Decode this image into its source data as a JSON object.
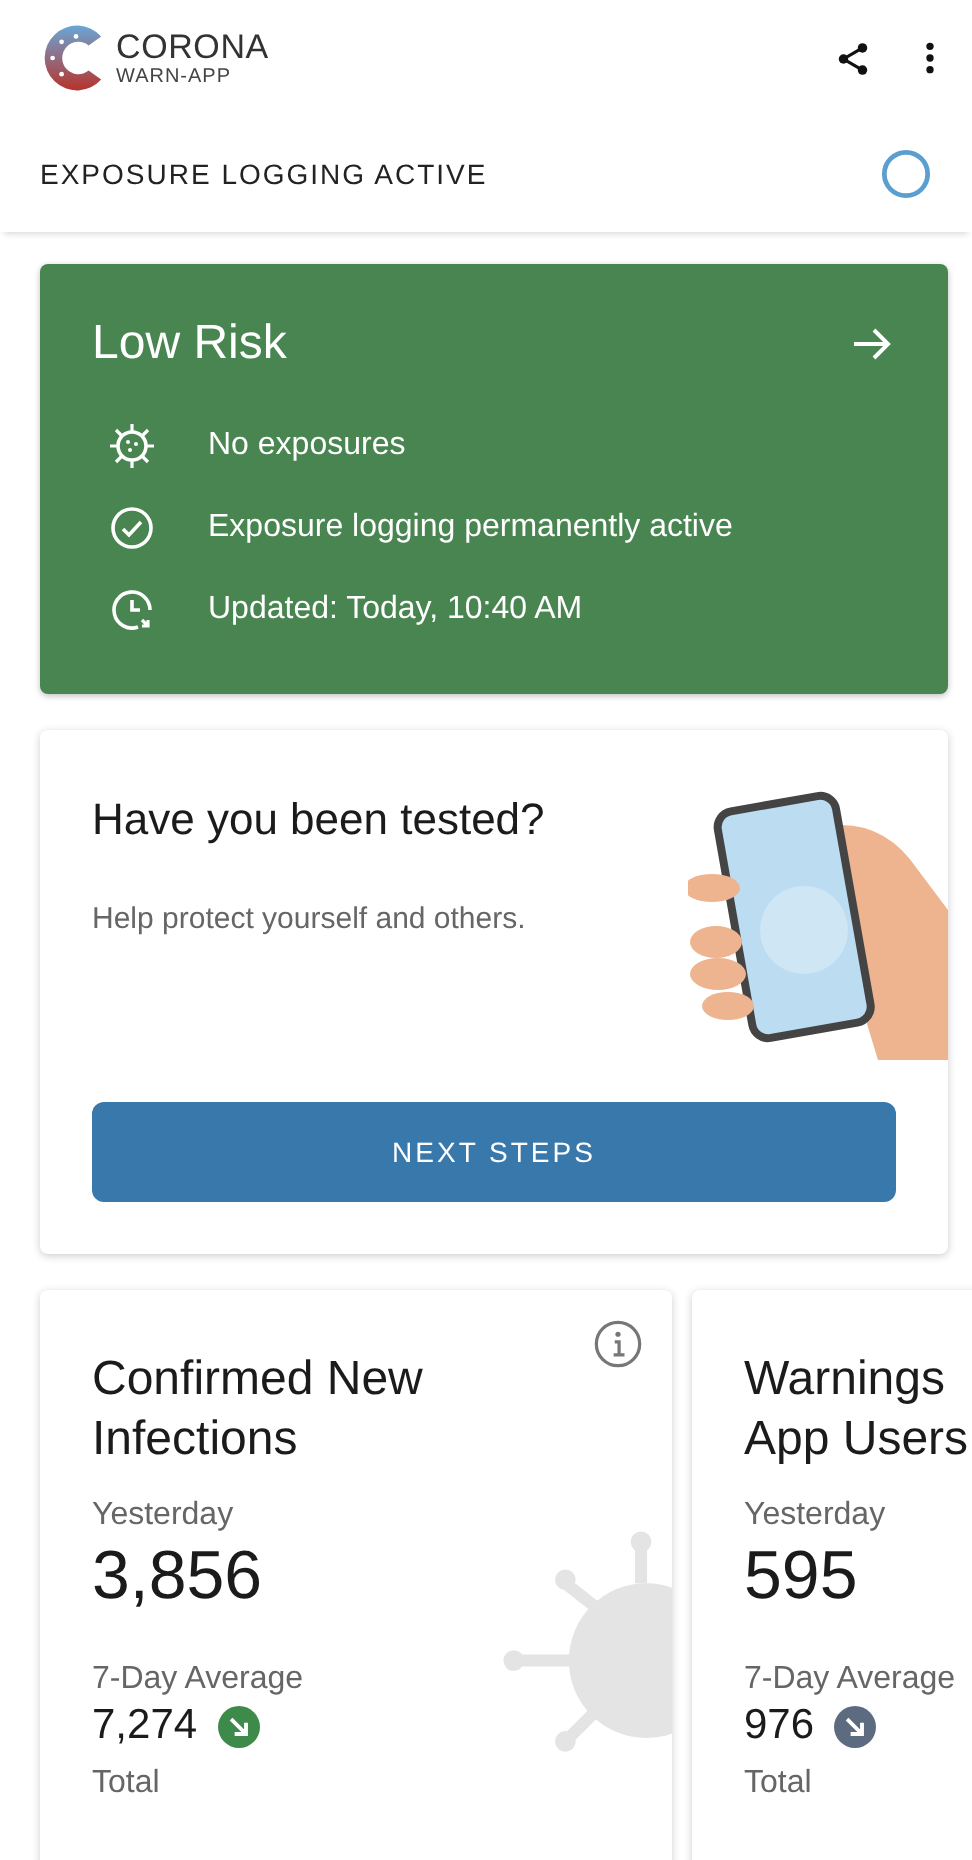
{
  "app_bar": {
    "logo_title": "CORONA",
    "logo_subtitle": "WARN-APP"
  },
  "status": {
    "label": "EXPOSURE LOGGING ACTIVE"
  },
  "risk_card": {
    "title": "Low Risk",
    "items": [
      {
        "kind": "virus",
        "text": "No exposures"
      },
      {
        "kind": "check",
        "text": "Exposure logging permanently active"
      },
      {
        "kind": "clock",
        "text": "Updated: Today, 10:40 AM"
      }
    ]
  },
  "test_card": {
    "title": "Have you been tested?",
    "text": "Help protect yourself and others.",
    "button": "NEXT STEPS"
  },
  "stats": [
    {
      "title_lines": [
        "Confirmed New",
        "Infections"
      ],
      "info": true,
      "yesterday_label": "Yesterday",
      "yesterday": "3,856",
      "average_label": "7-Day Average",
      "average": "7,274",
      "color": "#3e8a4a",
      "total_label": "Total"
    },
    {
      "title_lines": [
        "Warnings",
        "App Users"
      ],
      "info": false,
      "yesterday_label": "Yesterday",
      "yesterday": "595",
      "average_label": "7-Day Average",
      "average": "976",
      "color": "#5d6b80",
      "total_label": "Total"
    }
  ]
}
